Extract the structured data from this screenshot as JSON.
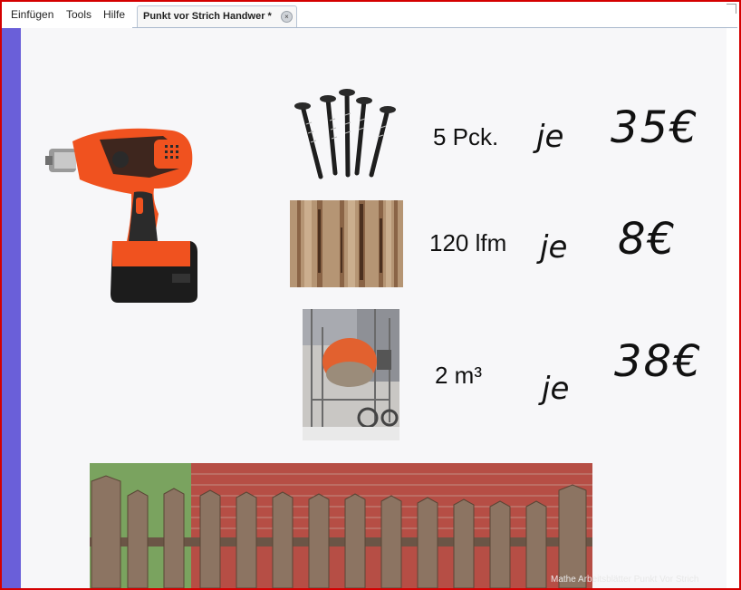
{
  "menu": {
    "items": [
      "Einfügen",
      "Tools",
      "Hilfe"
    ]
  },
  "tab": {
    "title": "Punkt vor Strich Handwer *",
    "close_glyph": "×"
  },
  "rows": [
    {
      "quantity": "5 Pck.",
      "je": "je",
      "price": "35€"
    },
    {
      "quantity": "120 lfm",
      "je": "je",
      "price": "8€"
    },
    {
      "quantity": "2 m³",
      "je": "je",
      "price": "38€"
    }
  ],
  "watermark": "Mathe Arbeitsblätter Punkt Vor Strich",
  "icons": {
    "drill": "cordless-drill-icon",
    "screws": "screws-icon",
    "wood": "wood-planks-icon",
    "mixer": "cement-mixer-icon",
    "fence": "fence-wall-photo"
  },
  "colors": {
    "frame_border": "#d40000",
    "side_strip": "#6a5fd9",
    "drill_orange": "#f0521f"
  }
}
